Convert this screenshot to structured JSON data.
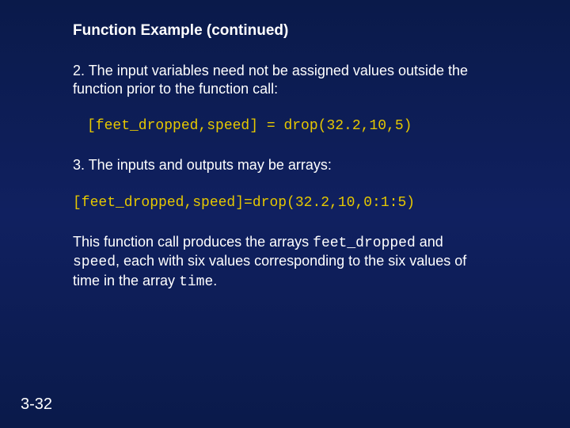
{
  "title": "Function Example (continued)",
  "para1": "2. The input variables need not be assigned values outside the function prior to the function call:",
  "code1": "[feet_dropped,speed] = drop(32.2,10,5)",
  "para2": "3. The inputs and outputs may be arrays:",
  "code2": "[feet_dropped,speed]=drop(32.2,10,0:1:5)",
  "para3_a": "This function call produces the arrays ",
  "para3_b": "feet_dropped",
  "para3_c": " and ",
  "para3_d": "speed",
  "para3_e": ", each with six values corresponding to the six values of time in the array ",
  "para3_f": "time",
  "para3_g": ".",
  "slideNumber": "3-32"
}
